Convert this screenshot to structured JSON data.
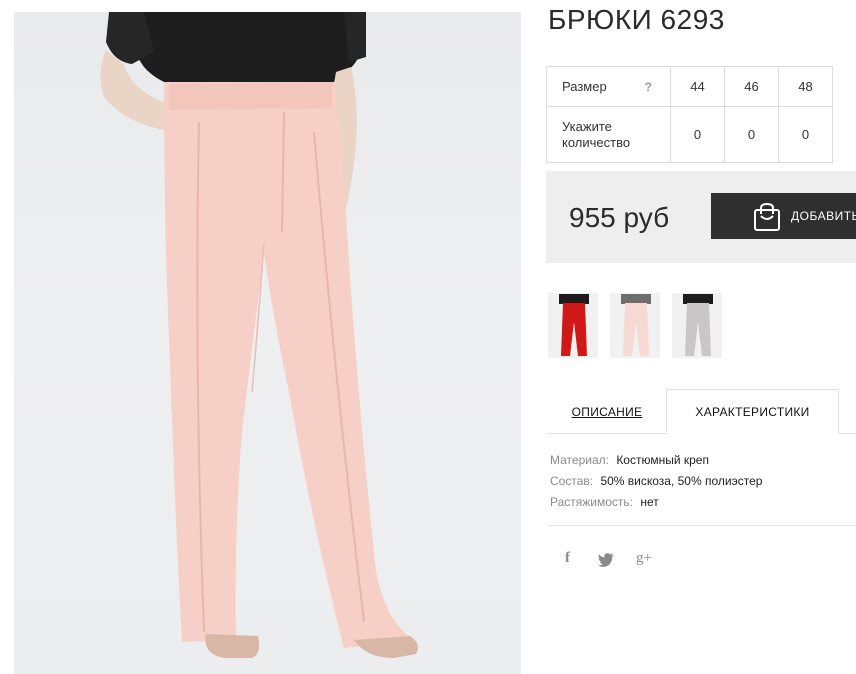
{
  "product": {
    "title": "БРЮКИ 6293",
    "price": "955 руб",
    "add_to_cart_label": "ДОБАВИТЬ"
  },
  "size_table": {
    "size_label": "Размер",
    "help_glyph": "?",
    "quantity_label": "Укажите количество",
    "sizes": [
      "44",
      "46",
      "48"
    ],
    "quantities": [
      "0",
      "0",
      "0"
    ]
  },
  "color_variants": [
    {
      "name": "red-pants",
      "color": "#d01818"
    },
    {
      "name": "pink-pants",
      "color": "#f7d9d3"
    },
    {
      "name": "grey-pants",
      "color": "#c9c6c8"
    }
  ],
  "tabs": {
    "description": "ОПИСАНИЕ",
    "characteristics": "ХАРАКТЕРИСТИКИ",
    "active": "characteristics"
  },
  "specs": [
    {
      "key": "Материал:",
      "value": "Костюмный креп"
    },
    {
      "key": "Состав:",
      "value": "50% вискоза, 50% полиэстер"
    },
    {
      "key": "Растяжимость:",
      "value": "нет"
    }
  ],
  "social": {
    "facebook": "f",
    "twitter": "🐦",
    "googleplus": "g+"
  },
  "colors": {
    "pants": "#f6cfc6",
    "top": "#1c1c1c",
    "button_bg": "#2f2f2f",
    "price_bg": "#eeeeee"
  }
}
